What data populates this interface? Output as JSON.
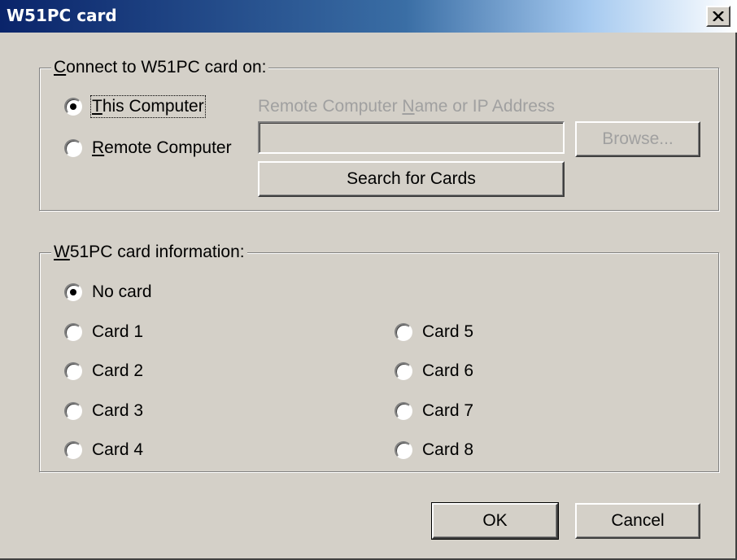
{
  "window": {
    "title": "W51PC card",
    "close_symbol": "×"
  },
  "connect_group": {
    "legend_underlined": "C",
    "legend_rest": "onnect to W51PC card on:",
    "this_computer_underlined": "T",
    "this_computer_rest": "his Computer",
    "remote_computer_underlined": "R",
    "remote_computer_rest": "emote Computer",
    "remote_name_before": "Remote Computer ",
    "remote_name_underlined": "N",
    "remote_name_after": "ame or IP Address",
    "remote_name_value": "",
    "browse_label": "Browse...",
    "search_label": "Search for Cards",
    "selected": "This Computer"
  },
  "info_group": {
    "legend_underlined": "W",
    "legend_rest": "51PC card information:",
    "no_card_label": "No card",
    "cards": [
      "Card 1",
      "Card 2",
      "Card 3",
      "Card 4",
      "Card 5",
      "Card 6",
      "Card 7",
      "Card 8"
    ],
    "selected": "No card"
  },
  "buttons": {
    "ok_label": "OK",
    "cancel_label": "Cancel"
  }
}
